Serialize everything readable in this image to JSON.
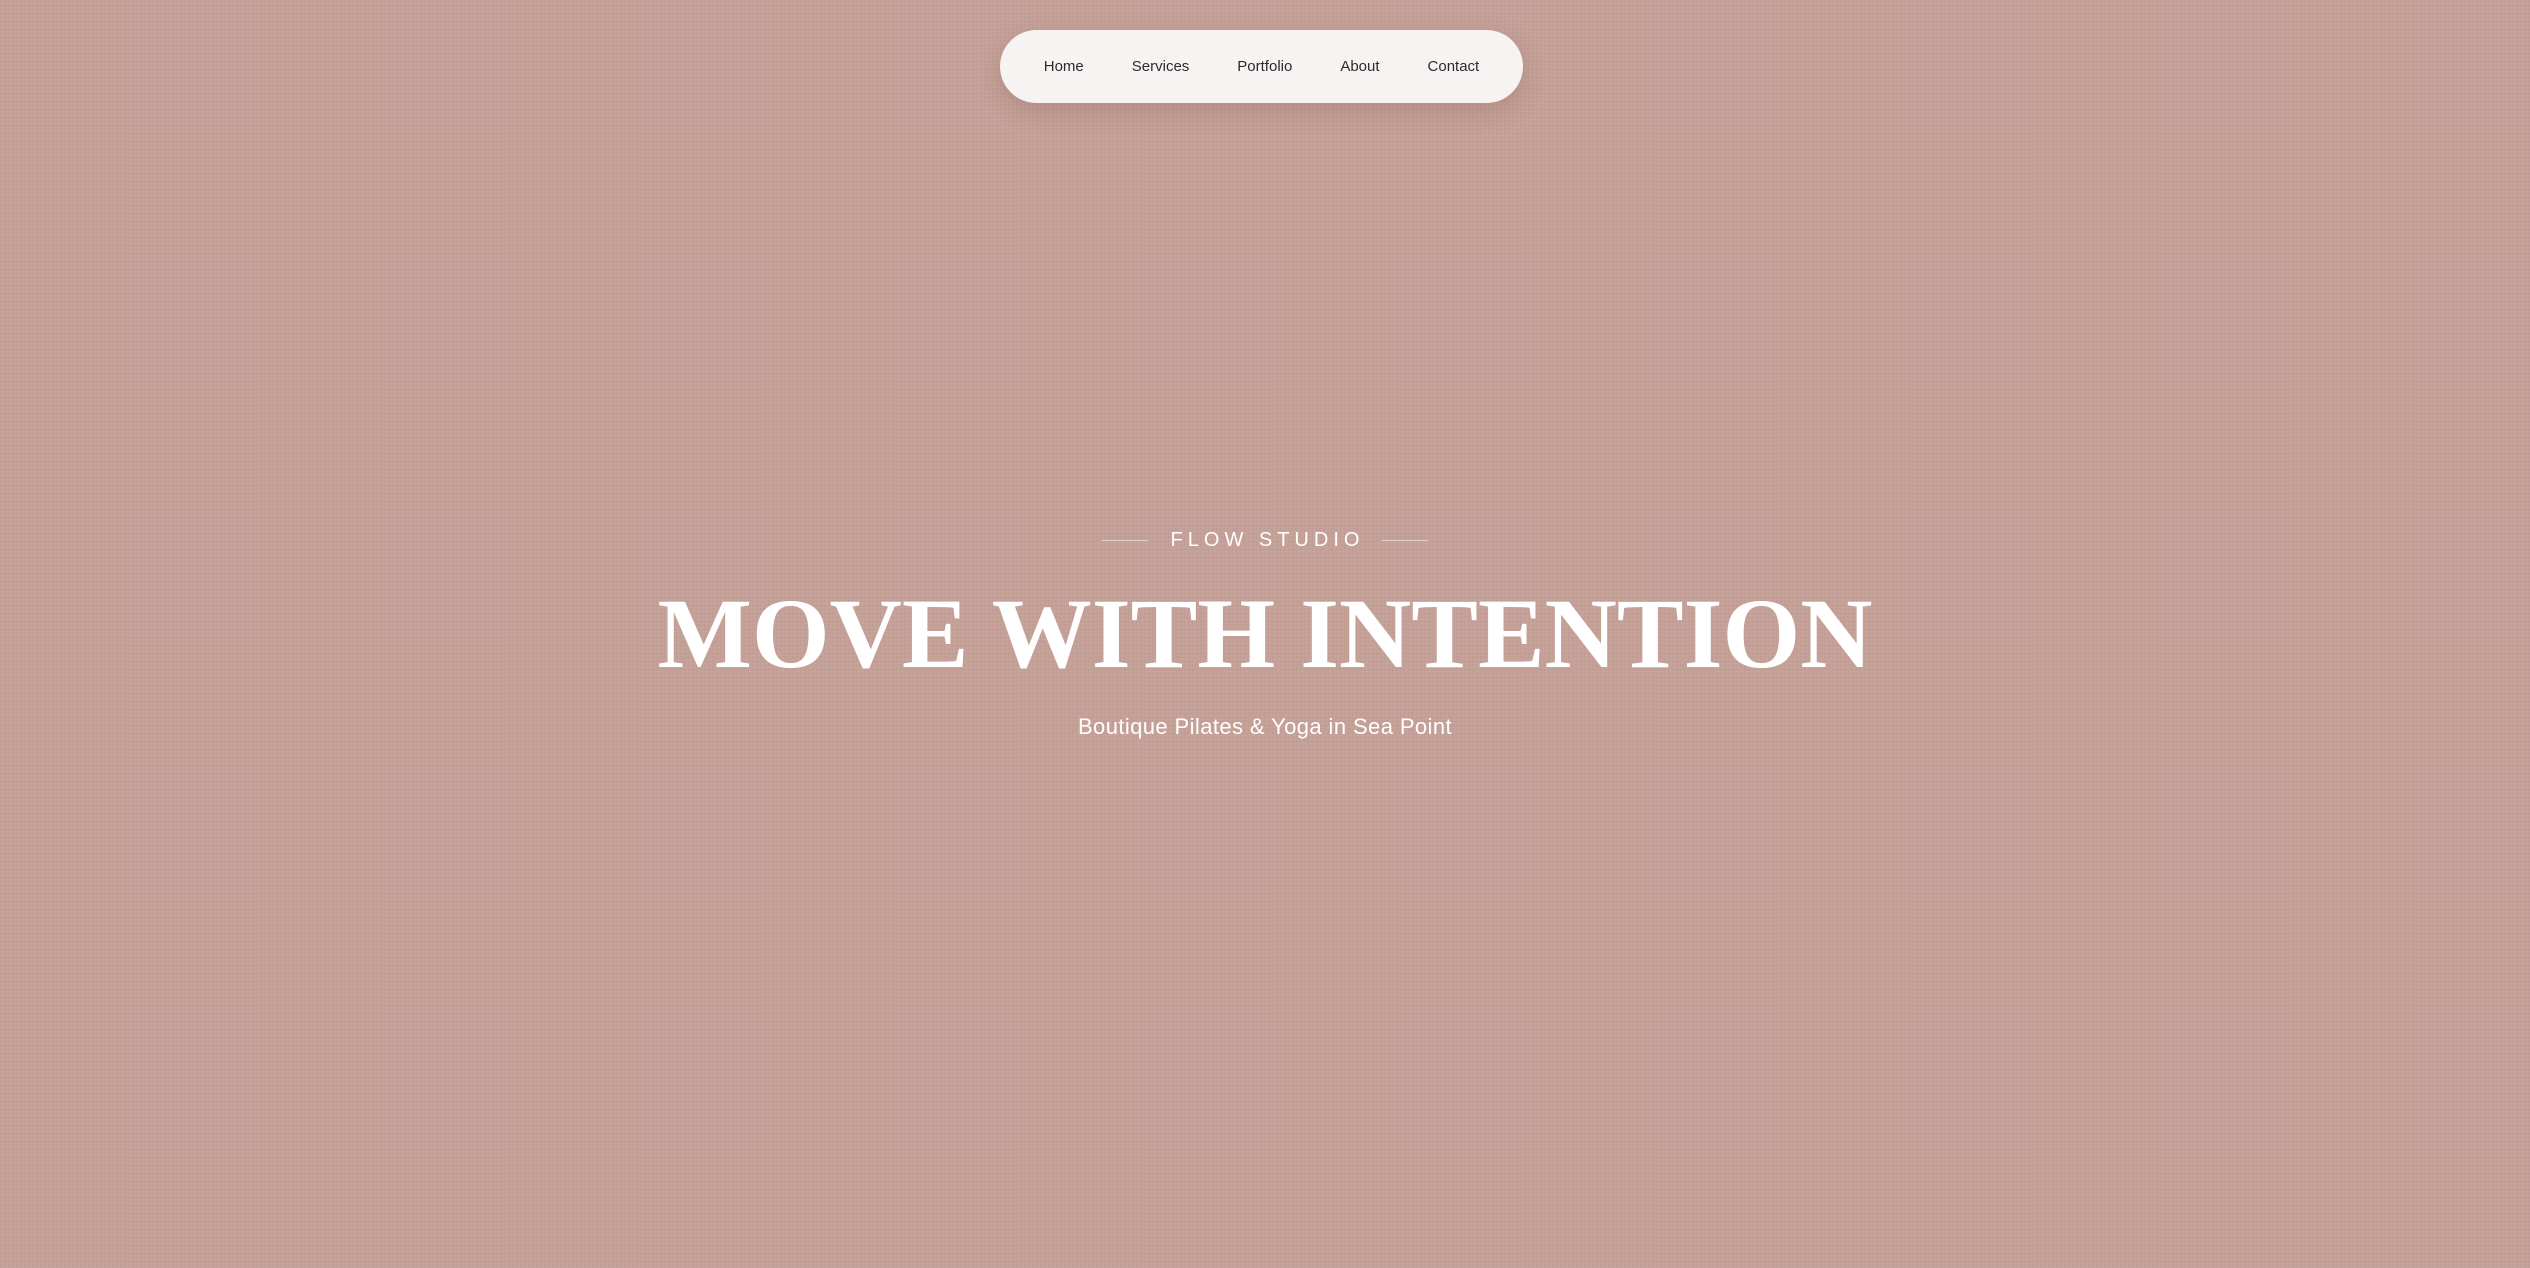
{
  "nav": {
    "items": [
      {
        "label": "Home"
      },
      {
        "label": "Services"
      },
      {
        "label": "Portfolio"
      },
      {
        "label": "About"
      },
      {
        "label": "Contact"
      }
    ]
  },
  "hero": {
    "eyebrow": "FLOW STUDIO",
    "headline": "MOVE WITH INTENTION",
    "subtitle": "Boutique Pilates & Yoga in Sea Point"
  },
  "colors": {
    "background": "#c4a198",
    "nav_background": "#f7f3f2",
    "nav_text": "#2b2b2b",
    "hero_text": "#ffffff"
  }
}
